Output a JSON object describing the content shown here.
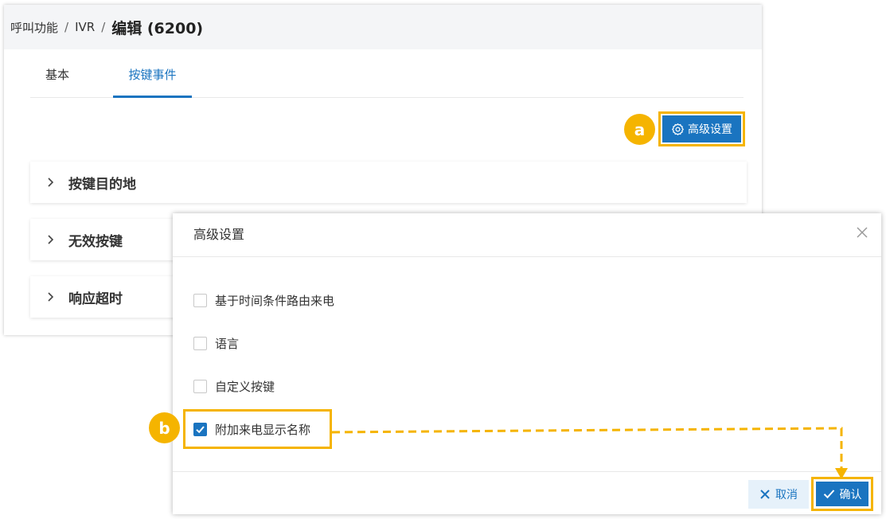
{
  "breadcrumb": {
    "items": [
      "呼叫功能",
      "IVR"
    ],
    "separator": "/",
    "current": "编辑 (6200)"
  },
  "tabs": [
    {
      "label": "基本",
      "active": false
    },
    {
      "label": "按键事件",
      "active": true
    }
  ],
  "toolbar": {
    "advanced_settings_label": "高级设置"
  },
  "annotations": {
    "a": "a",
    "b": "b"
  },
  "sections": [
    {
      "label": "按键目的地"
    },
    {
      "label": "无效按键"
    },
    {
      "label": "响应超时"
    }
  ],
  "modal": {
    "title": "高级设置",
    "options": [
      {
        "label": "基于时间条件路由来电",
        "checked": false
      },
      {
        "label": "语言",
        "checked": false
      },
      {
        "label": "自定义按键",
        "checked": false
      },
      {
        "label": "附加来电显示名称",
        "checked": true
      }
    ],
    "cancel_label": "取消",
    "confirm_label": "确认"
  },
  "colors": {
    "accent": "#1a74c0",
    "highlight": "#f5b400",
    "breadcrumb_bg": "#f4f5f7",
    "cancel_bg": "#e6f1fa"
  }
}
